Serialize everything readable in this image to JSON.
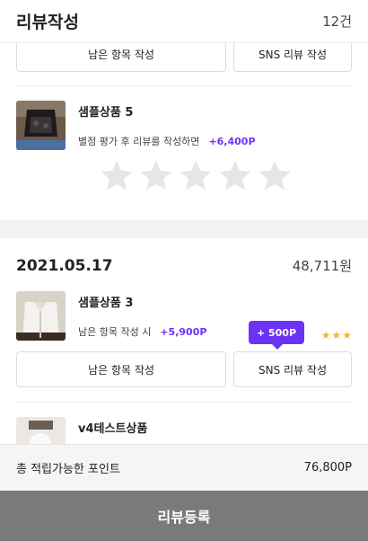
{
  "header": {
    "title": "리뷰작성",
    "count": "12건"
  },
  "buttons": {
    "remaining": "남은 항목 작성",
    "sns": "SNS 리뷰 작성"
  },
  "products": [
    {
      "name": "샘플상품 5",
      "desc": "별점 평가 후 리뷰를 작성하면",
      "point": "+6,400P",
      "rating": 0
    },
    {
      "name": "샘플상품 3",
      "desc": "남은 항목 작성 시",
      "point": "+5,900P",
      "rating": 3
    },
    {
      "name": "v4테스트상품"
    }
  ],
  "order2": {
    "date": "2021.05.17",
    "amount": "48,711원"
  },
  "tooltip": "+ 500P",
  "footer": {
    "label": "총 적립가능한 포인트",
    "value": "76,800P"
  },
  "submit": "리뷰등록",
  "colors": {
    "accent": "#6b34f5",
    "star_empty": "#e6e6e6",
    "star_filled": "#f2b43a",
    "submit_bg": "#7a7a7a"
  }
}
